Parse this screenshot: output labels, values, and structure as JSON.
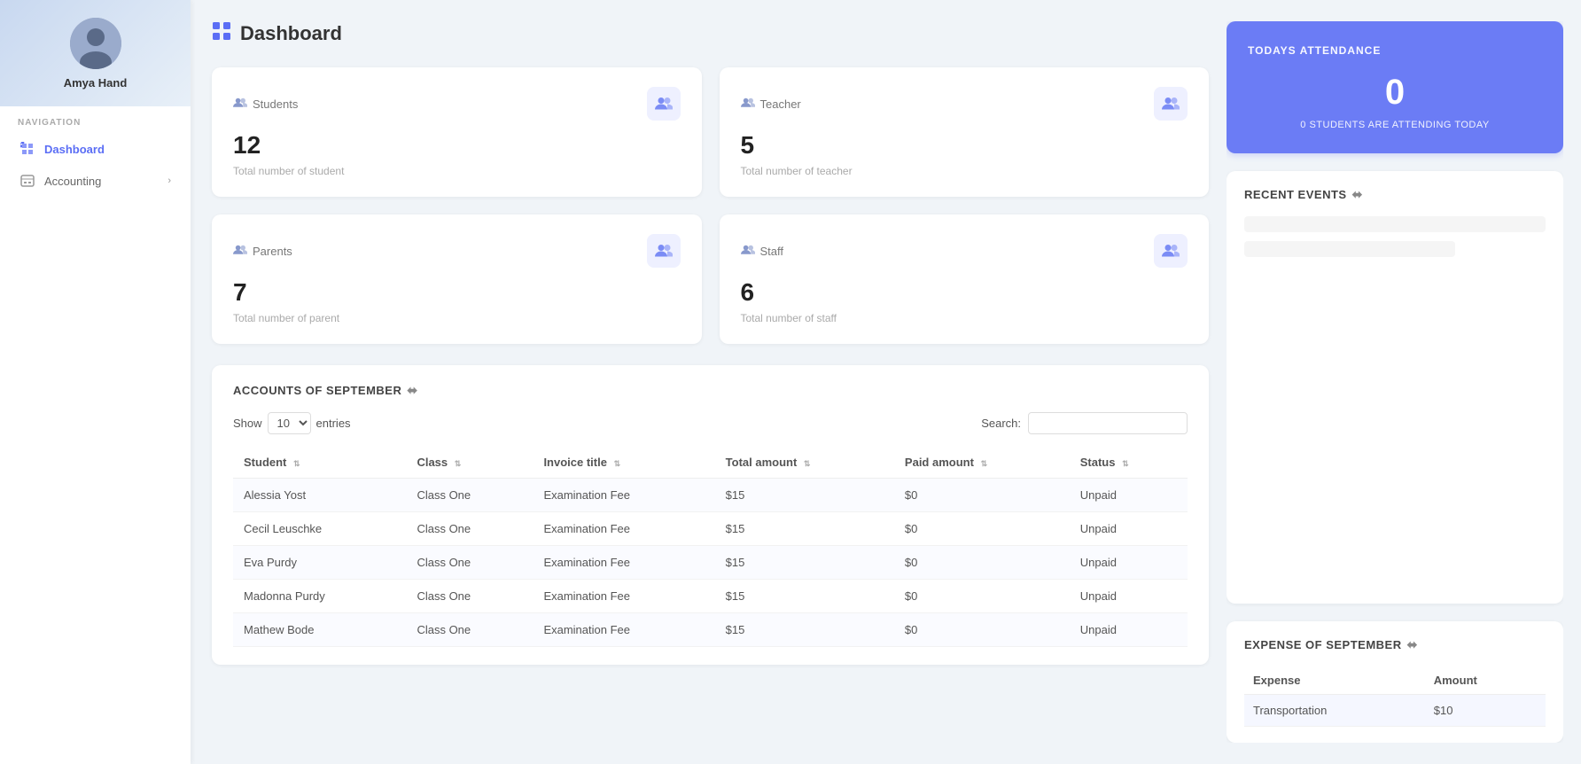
{
  "sidebar": {
    "user": {
      "name": "Amya Hand"
    },
    "nav_label": "NAVIGATION",
    "items": [
      {
        "id": "dashboard",
        "label": "Dashboard",
        "active": true,
        "has_chevron": false
      },
      {
        "id": "accounting",
        "label": "Accounting",
        "active": false,
        "has_chevron": true
      }
    ]
  },
  "header": {
    "title": "Dashboard",
    "icon": "▪"
  },
  "stats": [
    {
      "id": "students",
      "label": "Students",
      "value": "12",
      "desc": "Total number of student"
    },
    {
      "id": "teacher",
      "label": "Teacher",
      "value": "5",
      "desc": "Total number of teacher"
    },
    {
      "id": "parents",
      "label": "Parents",
      "value": "7",
      "desc": "Total number of parent"
    },
    {
      "id": "staff",
      "label": "Staff",
      "value": "6",
      "desc": "Total number of staff"
    }
  ],
  "accounts_table": {
    "title": "ACCOUNTS OF SEPTEMBER",
    "show_label": "Show",
    "entries_label": "entries",
    "entries_value": "10",
    "search_label": "Search:",
    "search_placeholder": "",
    "columns": [
      {
        "id": "student",
        "label": "Student"
      },
      {
        "id": "class",
        "label": "Class"
      },
      {
        "id": "invoice_title",
        "label": "Invoice title"
      },
      {
        "id": "total_amount",
        "label": "Total amount"
      },
      {
        "id": "paid_amount",
        "label": "Paid amount"
      },
      {
        "id": "status",
        "label": "Status"
      }
    ],
    "rows": [
      {
        "student": "Alessia Yost",
        "class": "Class One",
        "invoice_title": "Examination Fee",
        "total_amount": "$15",
        "paid_amount": "$0",
        "status": "Unpaid"
      },
      {
        "student": "Cecil Leuschke",
        "class": "Class One",
        "invoice_title": "Examination Fee",
        "total_amount": "$15",
        "paid_amount": "$0",
        "status": "Unpaid"
      },
      {
        "student": "Eva Purdy",
        "class": "Class One",
        "invoice_title": "Examination Fee",
        "total_amount": "$15",
        "paid_amount": "$0",
        "status": "Unpaid"
      },
      {
        "student": "Madonna Purdy",
        "class": "Class One",
        "invoice_title": "Examination Fee",
        "total_amount": "$15",
        "paid_amount": "$0",
        "status": "Unpaid"
      },
      {
        "student": "Mathew Bode",
        "class": "Class One",
        "invoice_title": "Examination Fee",
        "total_amount": "$15",
        "paid_amount": "$0",
        "status": "Unpaid"
      }
    ]
  },
  "attendance": {
    "title": "TODAYS ATTENDANCE",
    "value": "0",
    "subtitle": "0 STUDENTS ARE ATTENDING TODAY"
  },
  "recent_events": {
    "title": "RECENT EVENTS"
  },
  "expense": {
    "title": "EXPENSE OF SEPTEMBER",
    "columns": [
      {
        "id": "expense",
        "label": "Expense"
      },
      {
        "id": "amount",
        "label": "Amount"
      }
    ],
    "rows": [
      {
        "expense": "Transportation",
        "amount": "$10"
      }
    ]
  },
  "colors": {
    "accent": "#6b7cf5",
    "accent_light": "#eef0ff",
    "sidebar_active": "#5b6ef5"
  }
}
